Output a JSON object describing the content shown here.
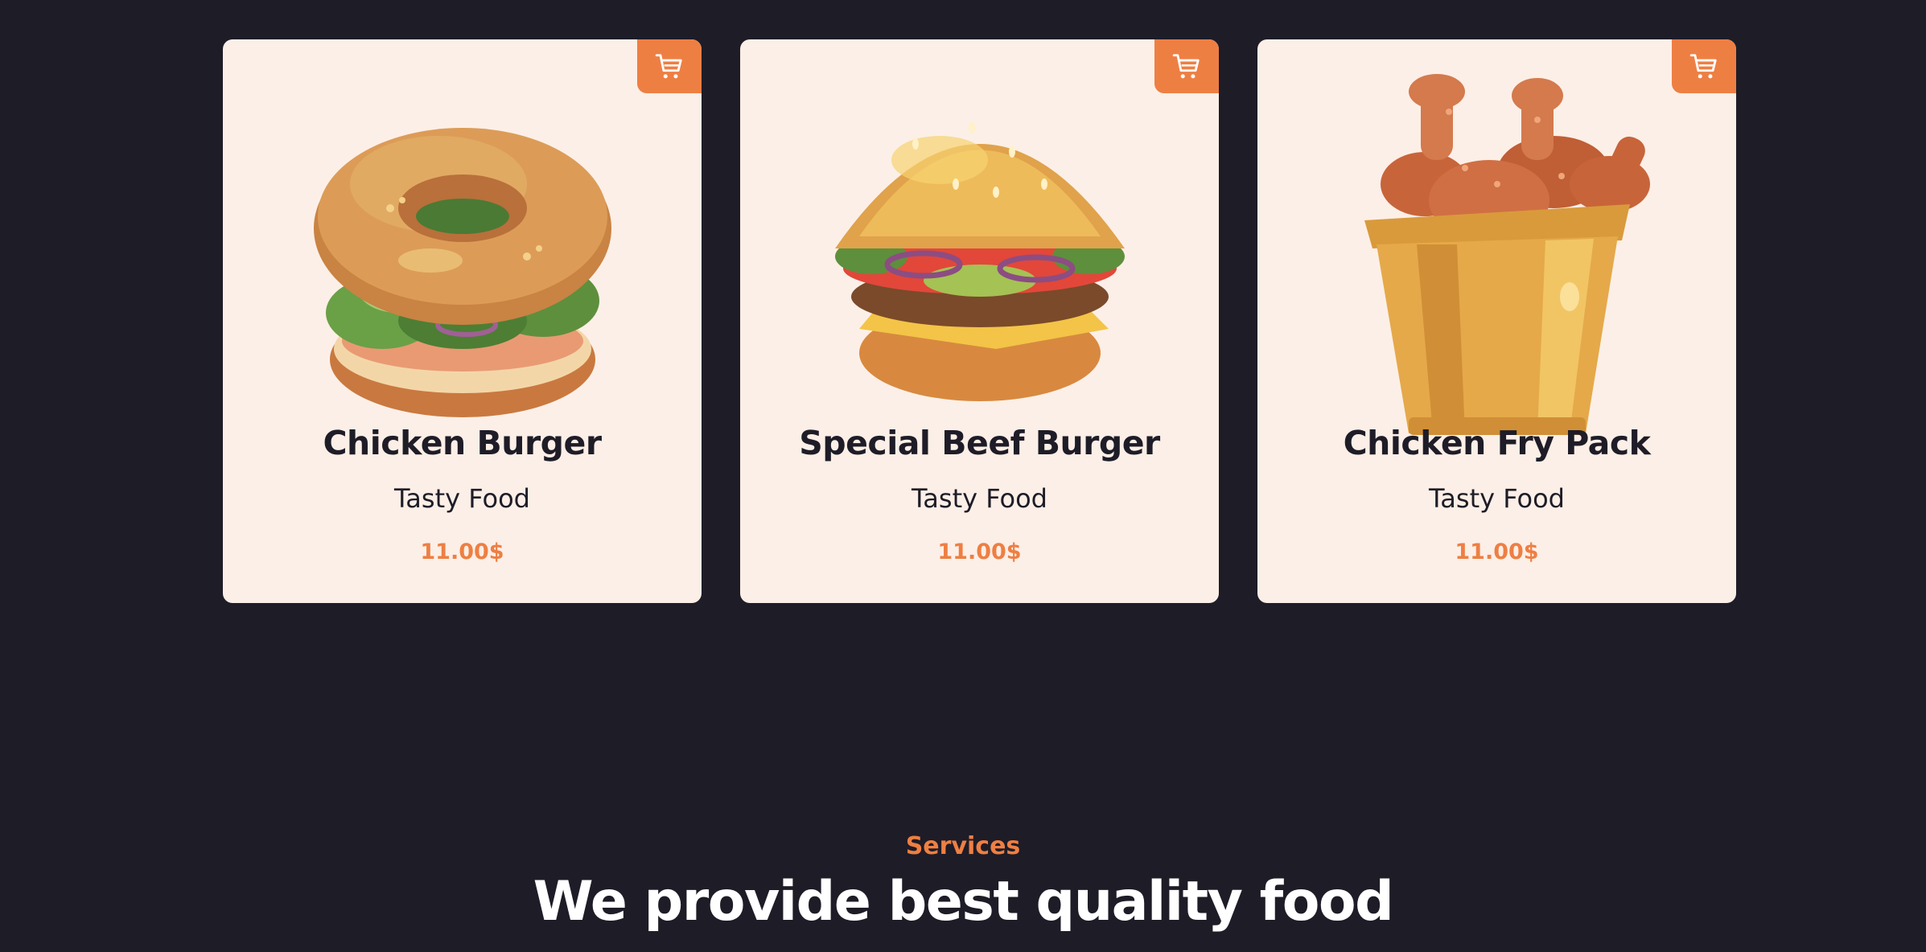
{
  "products": [
    {
      "title": "Chicken Burger",
      "subtitle": "Tasty Food",
      "price": "11.00$",
      "image": "bagel-burger-illustration"
    },
    {
      "title": "Special Beef Burger",
      "subtitle": "Tasty Food",
      "price": "11.00$",
      "image": "beef-burger-illustration"
    },
    {
      "title": "Chicken Fry Pack",
      "subtitle": "Tasty Food",
      "price": "11.00$",
      "image": "fried-chicken-bucket-illustration"
    }
  ],
  "cart_icon": "cart-icon",
  "services": {
    "label": "Services",
    "title": "We provide best quality food"
  },
  "colors": {
    "background": "#1e1c27",
    "card": "#fcefe7",
    "accent": "#ee7f43",
    "text_dark": "#1e1c27",
    "text_light": "#ffffff"
  }
}
